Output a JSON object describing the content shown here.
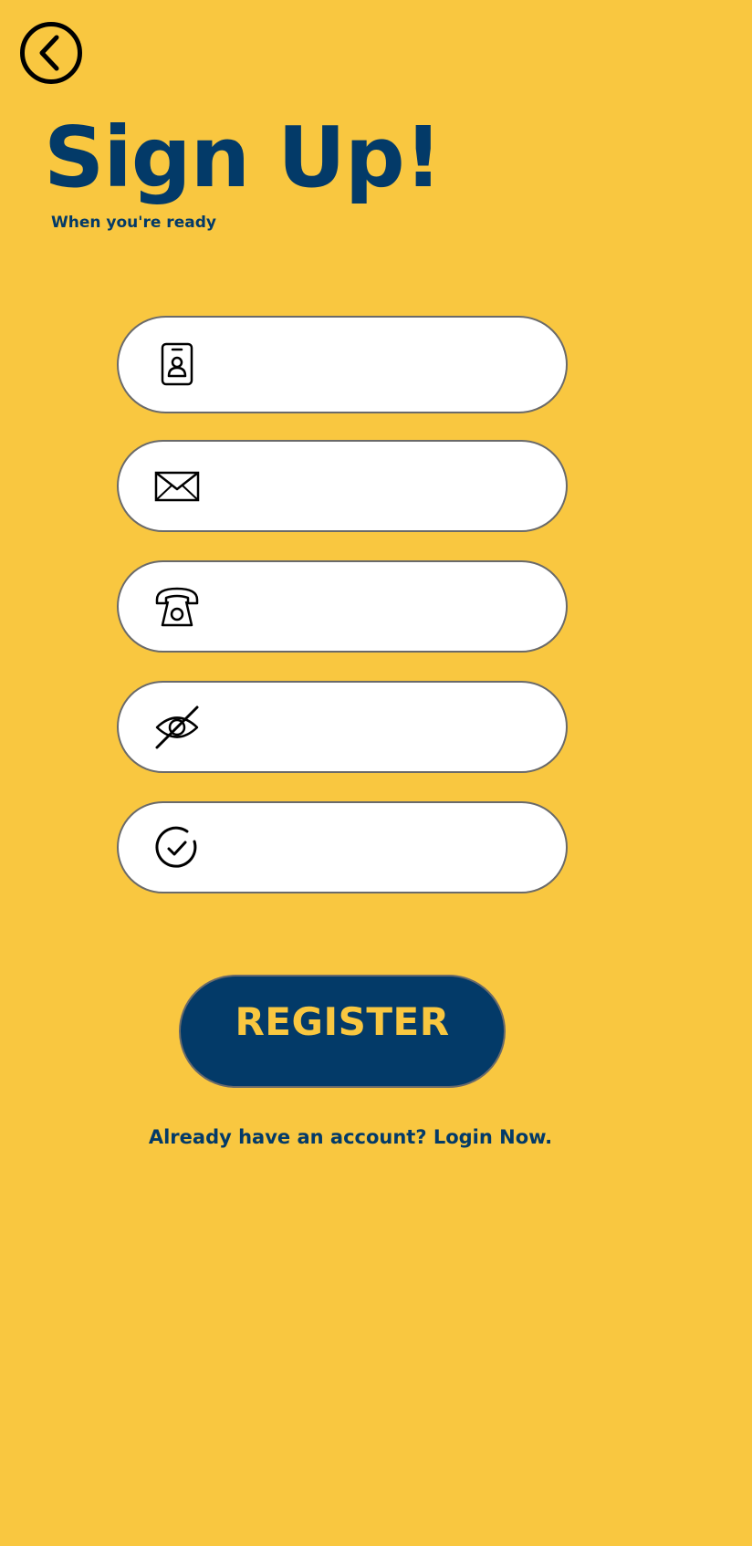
{
  "header": {
    "back_icon": "chevron-left-circle-icon",
    "title": "Sign Up!",
    "subtitle": "When you're ready"
  },
  "form": {
    "fields": [
      {
        "icon": "id-badge-icon",
        "value": "",
        "placeholder": ""
      },
      {
        "icon": "envelope-icon",
        "value": "",
        "placeholder": ""
      },
      {
        "icon": "telephone-icon",
        "value": "",
        "placeholder": ""
      },
      {
        "icon": "eye-slash-icon",
        "value": "",
        "placeholder": ""
      },
      {
        "icon": "check-circle-icon",
        "value": "",
        "placeholder": ""
      }
    ],
    "register_label": "REGISTER"
  },
  "footer": {
    "login_text": "Already have an account? Login Now."
  },
  "colors": {
    "background": "#F9C740",
    "primary": "#033A68",
    "field_bg": "#FFFFFF",
    "border": "#6A6A6A"
  }
}
